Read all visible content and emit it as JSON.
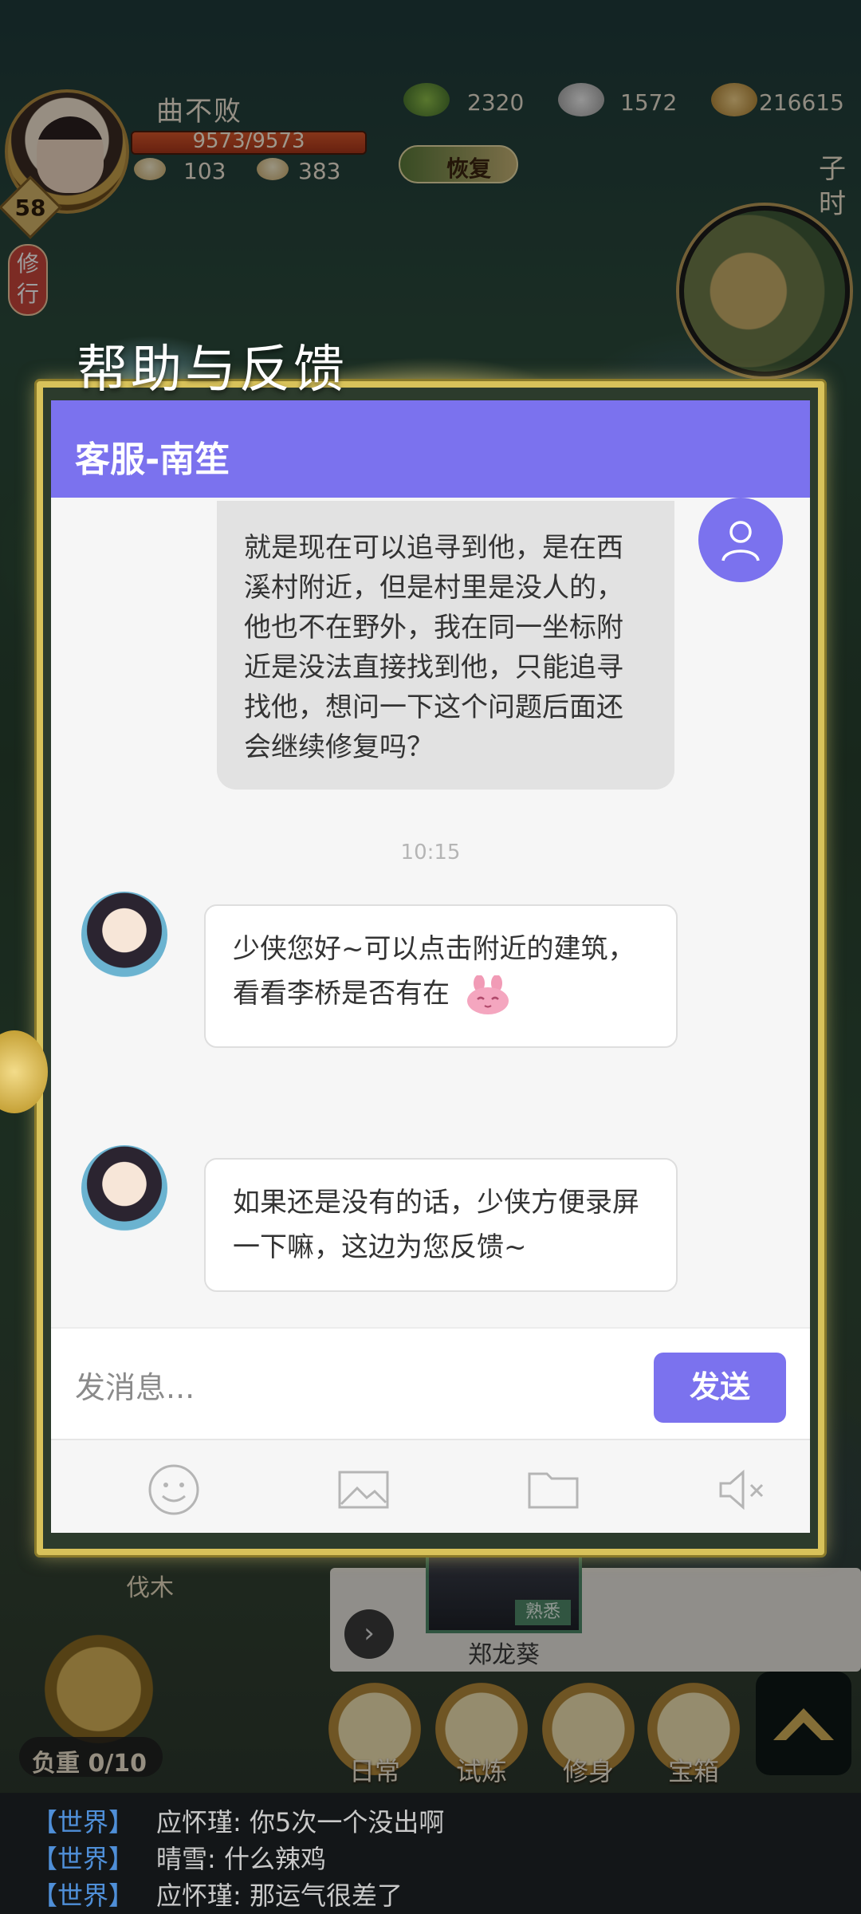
{
  "hud": {
    "player_name": "曲不败",
    "hp": "9573/9573",
    "level": "58",
    "stat_left": "103",
    "stat_right": "383",
    "currency_1": "2320",
    "currency_2": "1572",
    "currency_3": "216615",
    "restore_label": "恢复",
    "time_label": "子时",
    "practice_label": "修行"
  },
  "dialog": {
    "title": "帮助与反馈",
    "header": "客服-南笙"
  },
  "messages": [
    {
      "from": "user",
      "text": "就是现在可以追寻到他，是在西溪村附近，但是村里是没人的，他也不在野外，我在同一坐标附近是没法直接找到他，只能追寻找他，想问一下这个问题后面还会继续修复吗？"
    },
    {
      "from": "time",
      "text": "10:15"
    },
    {
      "from": "cs",
      "text": "少侠您好~可以点击附近的建筑，看看李桥是否有在"
    },
    {
      "from": "cs",
      "text": "如果还是没有的话，少侠方便录屏一下嘛，这边为您反馈~"
    }
  ],
  "composer": {
    "placeholder": "发消息...",
    "send_label": "发送"
  },
  "toolbar": {
    "icons": [
      "emoji-icon",
      "image-icon",
      "folder-icon",
      "mute-icon"
    ]
  },
  "bottom": {
    "cut_wood": "伐木",
    "npc_name": "郑龙葵",
    "npc_tag": "熟悉",
    "load": "负重 0/10",
    "menu": [
      "日常",
      "试炼",
      "修身",
      "宝箱"
    ]
  },
  "chat_log": [
    {
      "channel": "【世界】",
      "text": "应怀瑾: 你5次一个没出啊"
    },
    {
      "channel": "【世界】",
      "text": "晴雪: 什么辣鸡"
    },
    {
      "channel": "【世界】",
      "text": "应怀瑾: 那运气很差了"
    }
  ],
  "colors": {
    "accent": "#7b72ee",
    "frame_gold": "#d8c25a",
    "user_bubble": "#e2e2e2",
    "cs_bubble": "#ffffff"
  }
}
